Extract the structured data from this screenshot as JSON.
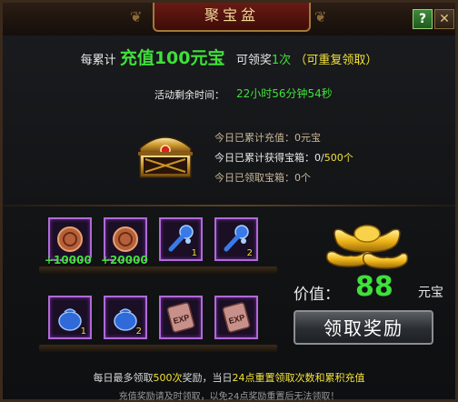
{
  "window": {
    "title": "聚宝盆",
    "help_label": "?",
    "close_label": "✕"
  },
  "promo": {
    "prefix": "每累计",
    "highlight": "充值100元宝",
    "mid": "可领奖",
    "times": "1次",
    "note": "（可重复领取）"
  },
  "timer": {
    "label": "活动剩余时间：",
    "value": "22小时56分钟54秒"
  },
  "stats": {
    "recharge_label": "今日已累计充值：",
    "recharge_value": "0元宝",
    "boxes_label": "今日已累计获得宝箱：",
    "boxes_got": "0",
    "boxes_sep": "/",
    "boxes_total": "500个",
    "claimed_label": "今日已领取宝箱：",
    "claimed_value": "0个"
  },
  "rewards": {
    "row1": [
      {
        "icon": "purple-medal-icon",
        "count": ""
      },
      {
        "icon": "purple-medal-icon",
        "count": ""
      },
      {
        "icon": "blue-key-icon",
        "count": "1"
      },
      {
        "icon": "blue-key-icon",
        "count": "2"
      }
    ],
    "row2": [
      {
        "icon": "blue-pouch-icon",
        "count": "1"
      },
      {
        "icon": "blue-pouch-icon",
        "count": "2"
      },
      {
        "icon": "exp-scroll-icon",
        "count": ""
      },
      {
        "icon": "exp-scroll-icon",
        "count": ""
      }
    ],
    "bonus1": "+10000",
    "bonus2": "+20000"
  },
  "value": {
    "label": "价值：",
    "number": "88",
    "unit": "元宝"
  },
  "claim_button": "领取奖励",
  "notice": {
    "line1_a": "每日最多领取",
    "line1_b": "500次",
    "line1_c": "奖励，当日",
    "line1_d": "24点",
    "line1_e": "重置领取次数和累积充值",
    "line2": "充值奖励请及时领取，以免24点奖励重置后无法领取！"
  },
  "colors": {
    "accent_green": "#3fe03a",
    "accent_yellow": "#f2e23a",
    "slot_border": "#b06ad8"
  }
}
